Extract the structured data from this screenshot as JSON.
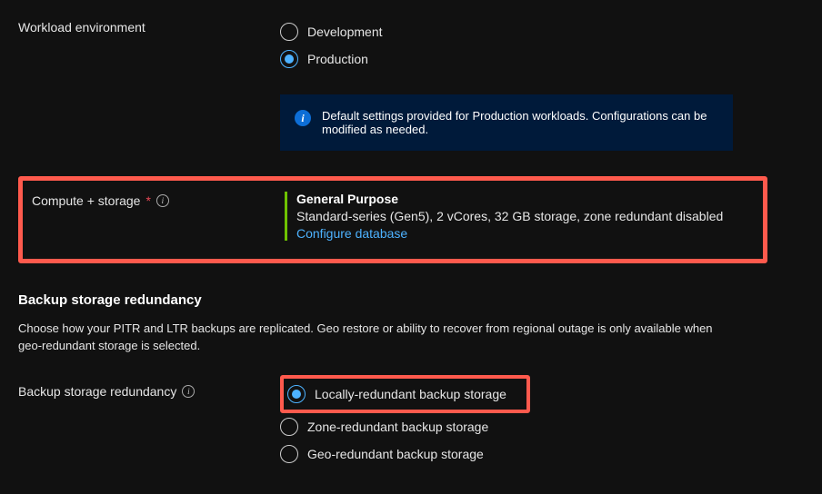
{
  "workload": {
    "label": "Workload environment",
    "dev": "Development",
    "prod": "Production"
  },
  "banner": {
    "text": "Default settings provided for Production workloads. Configurations can be modified as needed."
  },
  "compute": {
    "label": "Compute + storage",
    "title": "General Purpose",
    "detail": "Standard-series (Gen5), 2 vCores, 32 GB storage, zone redundant disabled",
    "link": "Configure database"
  },
  "backup": {
    "section_title": "Backup storage redundancy",
    "desc": "Choose how your PITR and LTR backups are replicated. Geo restore or ability to recover from regional outage is only available when geo-redundant storage is selected.",
    "label": "Backup storage redundancy",
    "local": "Locally-redundant backup storage",
    "zone": "Zone-redundant backup storage",
    "geo": "Geo-redundant backup storage"
  }
}
